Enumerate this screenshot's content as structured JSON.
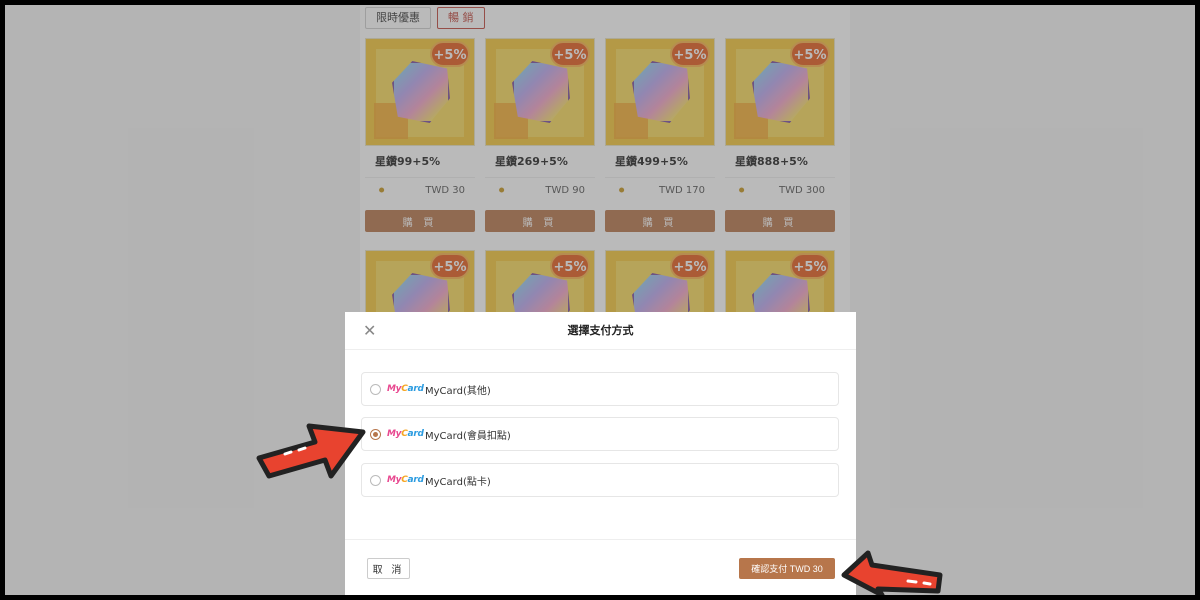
{
  "tabs": [
    {
      "label": "限時優惠"
    },
    {
      "label": "暢 銷"
    }
  ],
  "products": [
    {
      "name": "星鑽99+5%",
      "price": "TWD 30",
      "badge": "+5%",
      "buy_label": "購 買"
    },
    {
      "name": "星鑽269+5%",
      "price": "TWD 90",
      "badge": "+5%",
      "buy_label": "購 買"
    },
    {
      "name": "星鑽499+5%",
      "price": "TWD 170",
      "badge": "+5%",
      "buy_label": "購 買"
    },
    {
      "name": "星鑽888+5%",
      "price": "TWD 300",
      "badge": "+5%",
      "buy_label": "購 買"
    },
    {
      "badge": "+5%"
    },
    {
      "badge": "+5%"
    },
    {
      "badge": "+5%"
    },
    {
      "badge": "+5%"
    }
  ],
  "modal": {
    "title": "選擇支付方式",
    "close_icon": "close-icon",
    "options": [
      {
        "logo": "MyCard",
        "label": "MyCard(其他)",
        "selected": false
      },
      {
        "logo": "MyCard",
        "label": "MyCard(會員扣點)",
        "selected": true
      },
      {
        "logo": "MyCard",
        "label": "MyCard(點卡)",
        "selected": false
      }
    ],
    "cancel_label": "取 消",
    "confirm_label": "確認支付 TWD 30"
  },
  "colors": {
    "accent": "#b7764b",
    "arrow": "#e8432f",
    "badge": "#e65c1c",
    "tile": "#f5c637"
  }
}
